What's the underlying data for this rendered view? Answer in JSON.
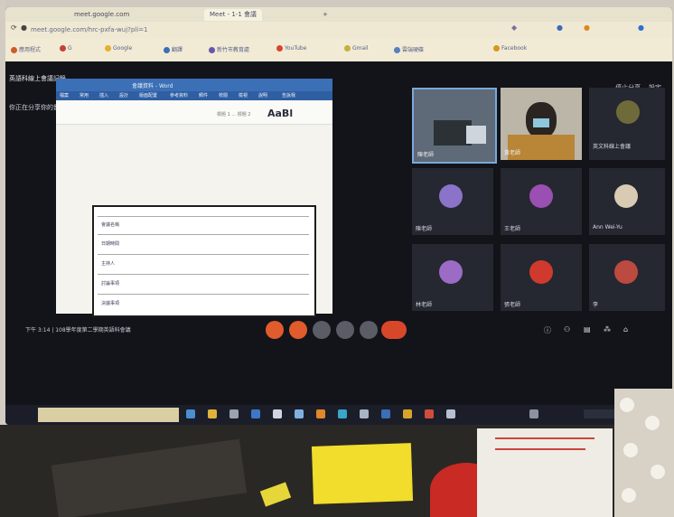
{
  "browser": {
    "tabs": [
      "meet.google.com",
      "Meet - 1-1 會議",
      "+"
    ],
    "url": "meet.google.com/hrc-pxfa-wuj?pli=1",
    "bookmarks": [
      "應用程式",
      "G",
      "Google",
      "翻譯",
      "新竹市教育處",
      "YouTube",
      "Gmail",
      "雲端硬碟",
      "Facebook"
    ]
  },
  "meet": {
    "title": "英語科線上會議記錄",
    "subtitle": "你正在分享你的畫面",
    "top_right": [
      "停止分享",
      "設定"
    ],
    "present_title": "會議資料 - Word",
    "present_style_hint": "標題 1 ... 標題 2",
    "present_style_sample": "AaBl",
    "ribbon_tabs": [
      "檔案",
      "常用",
      "插入",
      "設計",
      "版面配置",
      "參考資料",
      "郵件",
      "校閱",
      "檢視",
      "說明",
      "告訴我"
    ],
    "doc_rows": [
      "會議名稱",
      "日期時間",
      "主持人",
      "討論事項",
      "決議事項"
    ],
    "participants": [
      {
        "name": "陳老師",
        "avatar_color": "#8a73c8"
      },
      {
        "name": "王老師",
        "avatar_color": "#9a4fb3"
      },
      {
        "name": "Ann Wei-Yu",
        "avatar_color": "#d9cbb3"
      },
      {
        "name": "林老師",
        "avatar_color": "#9c6bc6"
      },
      {
        "name": "張老師",
        "avatar_color": "#d03a2e"
      },
      {
        "name": "李",
        "avatar_color": "#bc4a40"
      }
    ],
    "cam_tiles": [
      "陳老師",
      "黃老師"
    ],
    "top_tile_name": "英文科線上會議",
    "bottom_text": "下午 3:14 | 108學年度第二學期英語科會議",
    "sticky_note": ""
  },
  "colors": {
    "accent": "#3b6fb6",
    "end_call": "#d9472b"
  }
}
